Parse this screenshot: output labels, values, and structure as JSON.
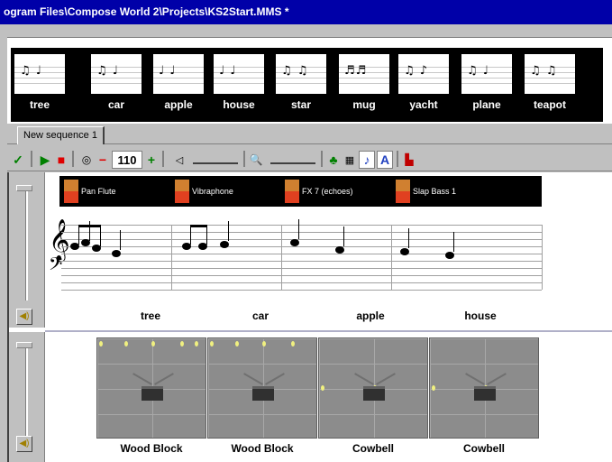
{
  "window": {
    "title": "ogram Files\\Compose World 2\\Projects\\KS2Start.MMS *"
  },
  "palette": {
    "items": [
      {
        "label": "tree",
        "notes": "♫ ♩"
      },
      {
        "label": "car",
        "notes": "♫ ♩"
      },
      {
        "label": "apple",
        "notes": "♩ ♩"
      },
      {
        "label": "house",
        "notes": "♩ ♩"
      },
      {
        "label": "star",
        "notes": "♫ ♫"
      },
      {
        "label": "mug",
        "notes": "♬♬"
      },
      {
        "label": "yacht",
        "notes": "♫ ♪"
      },
      {
        "label": "plane",
        "notes": "♫ ♩"
      },
      {
        "label": "teapot",
        "notes": "♫ ♫"
      }
    ]
  },
  "sequence_tab": {
    "label": "New sequence 1"
  },
  "toolbar": {
    "tempo": "110"
  },
  "tracks": {
    "melody": {
      "instruments": [
        "Pan Flute",
        "Vibraphone",
        "FX 7 (echoes)",
        "Slap Bass 1"
      ],
      "segments": [
        "tree",
        "car",
        "apple",
        "house"
      ]
    },
    "percussion": {
      "segments": [
        "Wood Block",
        "Wood Block",
        "Cowbell",
        "Cowbell"
      ]
    }
  }
}
